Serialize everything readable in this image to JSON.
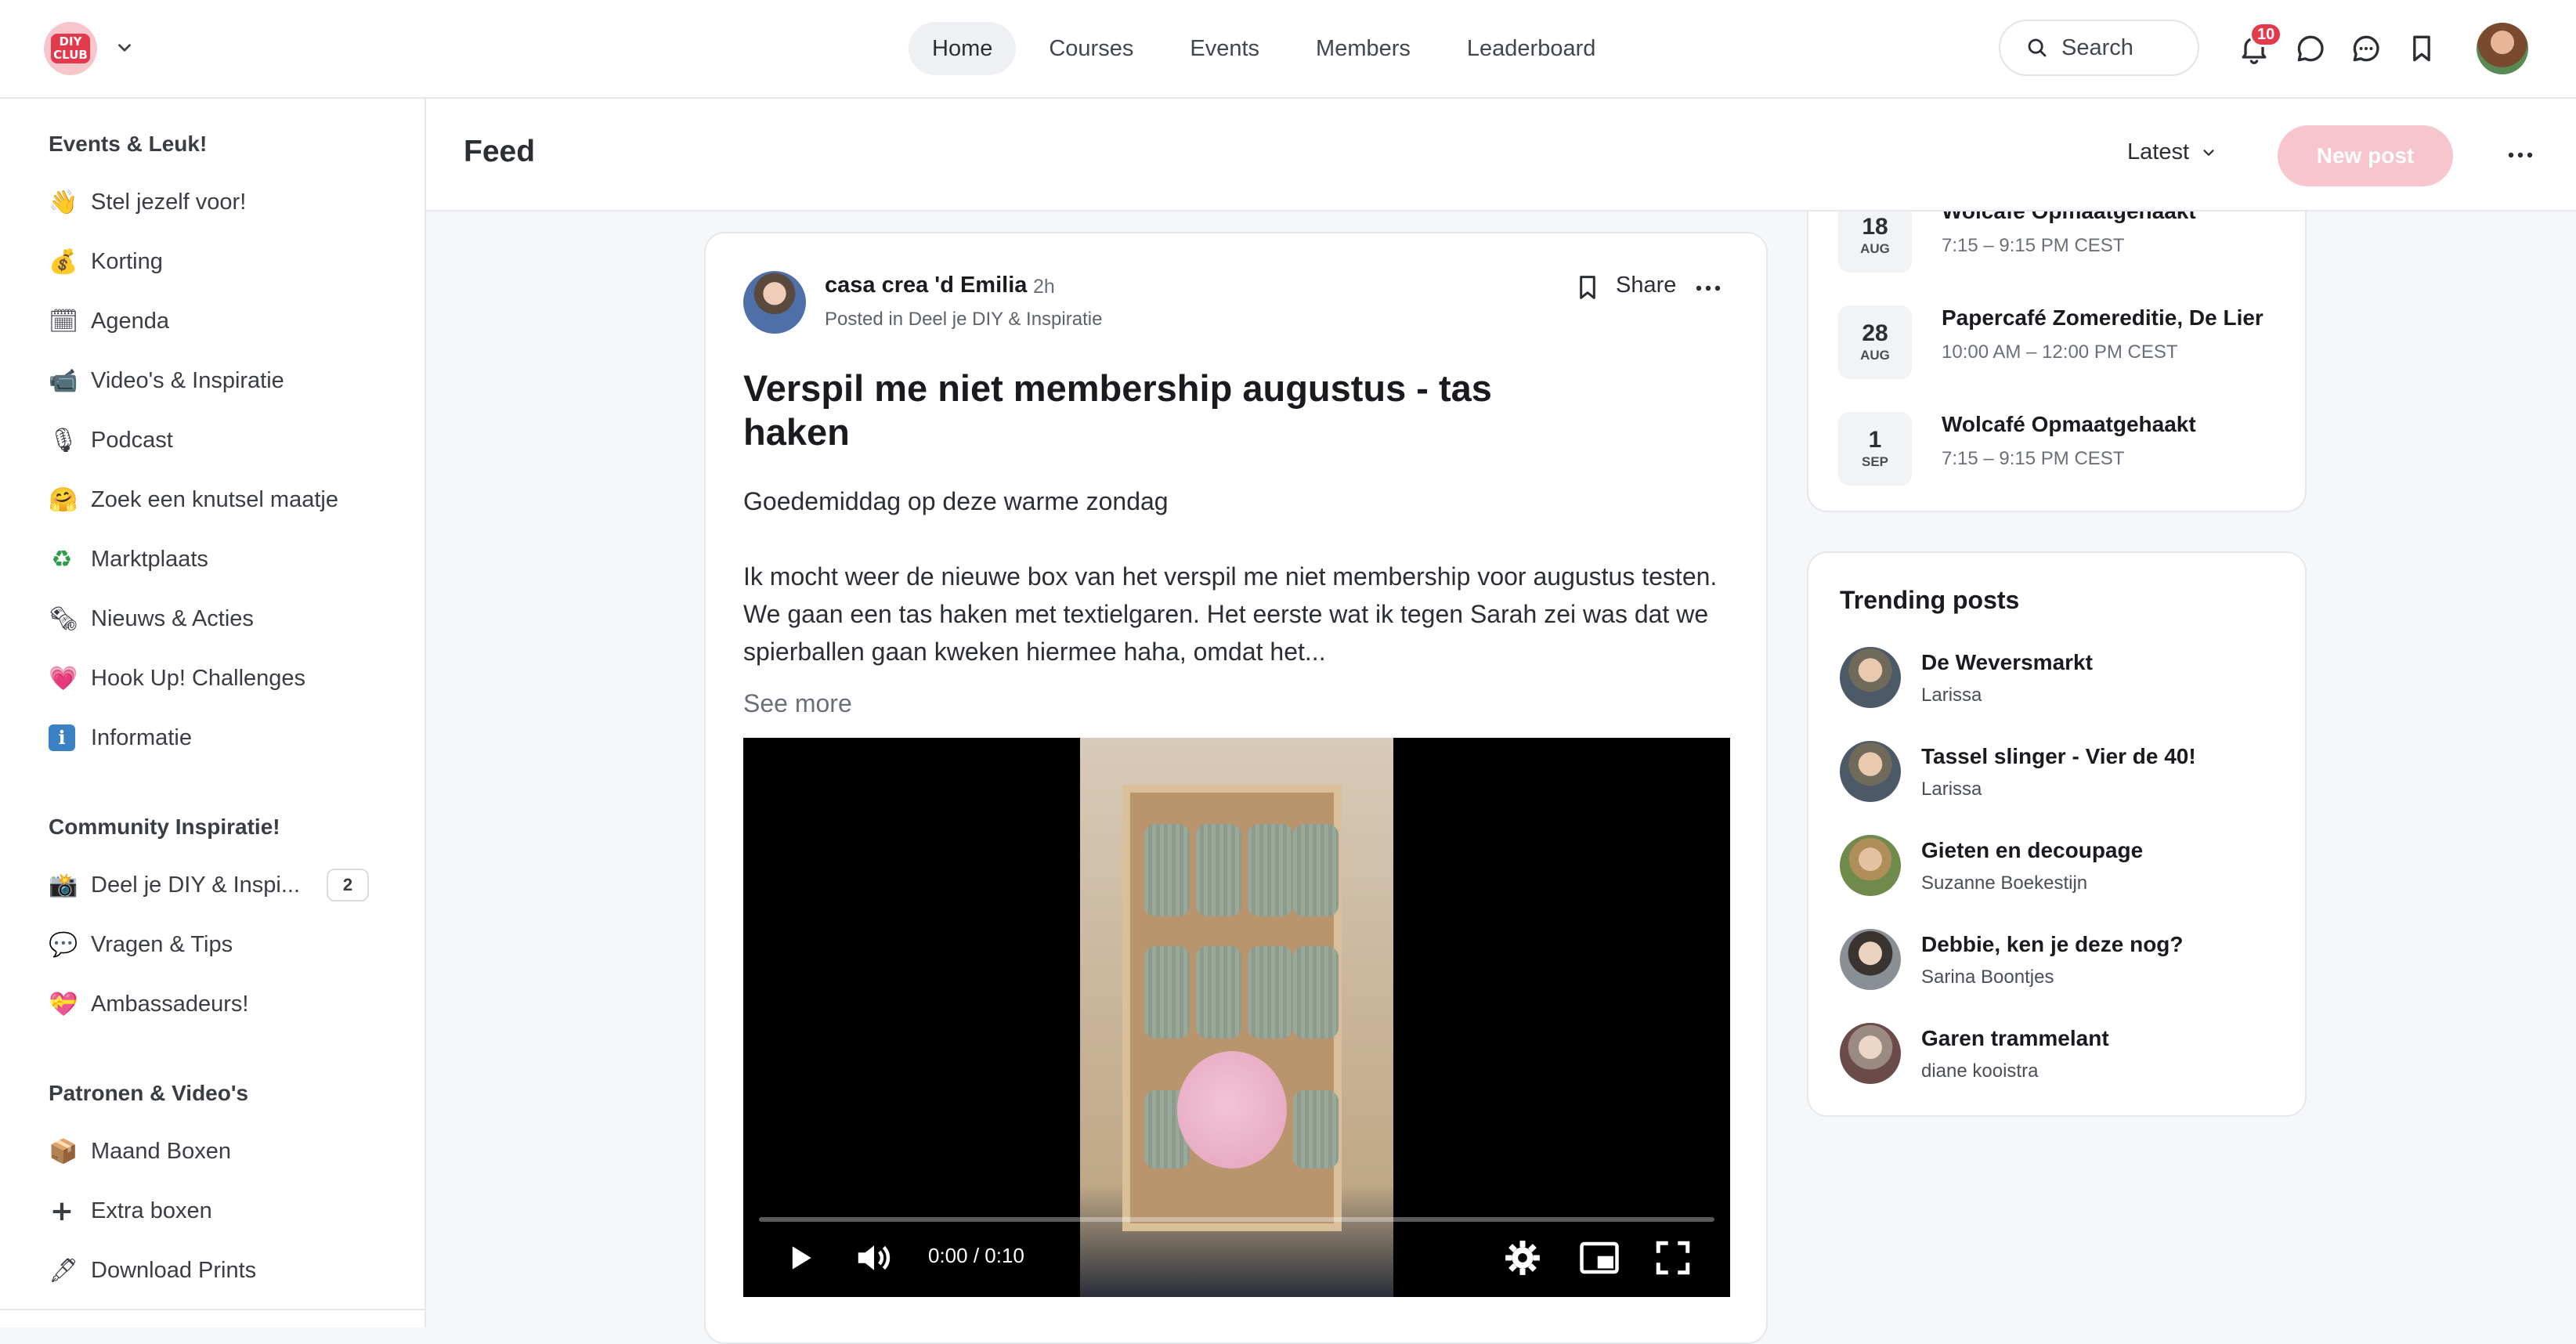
{
  "brand": {
    "logo_text": "DIY CLUB"
  },
  "nav": {
    "items": [
      {
        "label": "Home"
      },
      {
        "label": "Courses"
      },
      {
        "label": "Events"
      },
      {
        "label": "Members"
      },
      {
        "label": "Leaderboard"
      }
    ]
  },
  "topbar": {
    "search_label": "Search",
    "notification_count": "10",
    "icons": [
      "bell-icon",
      "chat-bubble-icon",
      "messages-icon",
      "bookmark-icon"
    ]
  },
  "sidebar": {
    "sections": [
      {
        "title": "Events & Leuk!",
        "items": [
          {
            "emoji": "👋",
            "label": "Stel jezelf voor!"
          },
          {
            "emoji": "💰",
            "label": "Korting"
          },
          {
            "emoji": "🗓",
            "label": "Agenda"
          },
          {
            "emoji": "📹",
            "label": "Video's & Inspiratie"
          },
          {
            "emoji": "🎙",
            "label": "Podcast"
          },
          {
            "emoji": "🤗",
            "label": "Zoek een knutsel maatje"
          },
          {
            "emoji": "♻",
            "label": "Marktplaats"
          },
          {
            "emoji": "🗞",
            "label": "Nieuws & Acties"
          },
          {
            "emoji": "💗",
            "label": "Hook Up! Challenges"
          },
          {
            "emoji": "ℹ",
            "label": "Informatie"
          }
        ]
      },
      {
        "title": "Community Inspiratie!",
        "items": [
          {
            "emoji": "📸",
            "label": "Deel je DIY & Inspi...",
            "count": "2"
          },
          {
            "emoji": "💬",
            "label": "Vragen & Tips"
          },
          {
            "emoji": "💝",
            "label": "Ambassadeurs!"
          }
        ]
      },
      {
        "title": "Patronen & Video's",
        "items": [
          {
            "emoji": "📦",
            "label": "Maand Boxen"
          },
          {
            "emoji": "+",
            "label": "Extra boxen"
          },
          {
            "emoji": "🖋",
            "label": "Download Prints"
          }
        ]
      }
    ]
  },
  "feed": {
    "title": "Feed",
    "sort_label": "Latest",
    "new_post_label": "New post"
  },
  "post": {
    "author": "casa crea 'd Emilia",
    "time": "2h",
    "posted_in": "Posted in Deel je DIY & Inspiratie",
    "share_label": "Share",
    "title": "Verspil me niet membership augustus - tas haken",
    "paragraph_1": "Goedemiddag op deze warme zondag",
    "paragraph_2": "Ik mocht weer de nieuwe box van het verspil me niet membership voor augustus testen. We gaan een tas haken met textielgaren. Het eerste wat ik tegen Sarah zei was dat we spierballen gaan kweken hiermee haha, omdat het...",
    "see_more": "See more",
    "video": {
      "time": "0:00 / 0:10",
      "progress": 0
    }
  },
  "events": [
    {
      "day": "18",
      "month": "AUG",
      "title": "Wolcafé Opmaatgehaakt",
      "time": "7:15 – 9:15 PM CEST"
    },
    {
      "day": "28",
      "month": "AUG",
      "title": "Papercafé Zomereditie, De Lier",
      "time": "10:00 AM – 12:00 PM CEST"
    },
    {
      "day": "1",
      "month": "SEP",
      "title": "Wolcafé Opmaatgehaakt",
      "time": "7:15 – 9:15 PM CEST"
    }
  ],
  "trending": {
    "title": "Trending posts",
    "items": [
      {
        "title": "De Weversmarkt",
        "author": "Larissa"
      },
      {
        "title": "Tassel slinger - Vier de 40!",
        "author": "Larissa"
      },
      {
        "title": "Gieten en decoupage",
        "author": "Suzanne Boekestijn"
      },
      {
        "title": "Debbie, ken je deze nog?",
        "author": "Sarina Boontjes"
      },
      {
        "title": "Garen trammelant",
        "author": "diane kooistra"
      }
    ]
  },
  "colors": {
    "accent": "#e2394b",
    "new_post_bg": "#f7c5cd",
    "page_bg": "#f6f7f9"
  }
}
